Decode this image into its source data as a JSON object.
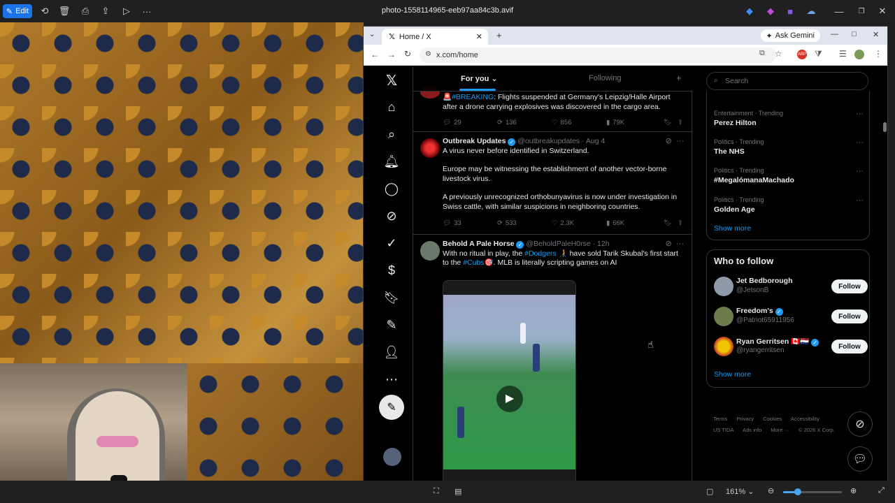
{
  "viewer": {
    "edit_label": "Edit",
    "title": "photo-1558114965-eeb97aa84c3b.avif",
    "zoom": "161%"
  },
  "browser": {
    "tab_title": "Home / X",
    "url": "x.com/home",
    "ask_gemini": "Ask Gemini"
  },
  "timeline": {
    "tab_for_you": "For you",
    "tab_following": "Following",
    "tweets": [
      {
        "text_prefix": "🚨",
        "hashtag": "#BREAKING",
        "text": ": Flights suspended at Germany's Leipzig/Halle Airport after a drone carrying explosives was discovered in the cargo area.",
        "replies": "29",
        "reposts": "136",
        "likes": "856",
        "views": "79K"
      },
      {
        "name": "Outbreak Updates",
        "handle": "@outbreakupdates · Aug 4",
        "p1": "A virus never before identified in Switzerland.",
        "p2": "Europe may be witnessing the establishment of another vector-borne livestock virus.",
        "p3": "A previously unrecognized orthobunyavirus is now under investigation in Swiss cattle, with similar suspicions in neighboring countries.",
        "replies": "33",
        "reposts": "533",
        "likes": "2.3K",
        "views": "66K"
      },
      {
        "name": "Behold A Pale Horse",
        "handle": "@BeholdPaleH0rse · 12h",
        "t1": "With no ritual in play, the ",
        "tag1": "#Dodgers",
        "t2": " 🧑‍🦯 have sold Tarik Skubal's first start to the ",
        "tag2": "#Cubs",
        "t3": "🎯. MLB is literally scripting games on AI"
      }
    ]
  },
  "sidebar": {
    "search_placeholder": "Search",
    "trends": [
      {
        "meta": "Entertainment · Trending",
        "name": "Perez Hilton"
      },
      {
        "meta": "Politics · Trending",
        "name": "The NHS"
      },
      {
        "meta": "Politics · Trending",
        "name": "#MegalómanaMachado"
      },
      {
        "meta": "Politics · Trending",
        "name": "Golden Age"
      }
    ],
    "show_more": "Show more",
    "who_to_follow": "Who to follow",
    "follow_label": "Follow",
    "accounts": [
      {
        "name": "Jet Bedborough",
        "handle": "@JetsonB"
      },
      {
        "name": "Freedom's",
        "handle": "@Patriot65911956"
      },
      {
        "name": "Ryan Gerritsen 🇨🇦🇳🇱",
        "handle": "@ryangerritsen"
      }
    ],
    "footer": [
      "Terms",
      "Privacy",
      "Cookies",
      "Accessibility",
      "US TIDA",
      "Ads info",
      "More ···",
      "© 2026 X Corp."
    ]
  }
}
